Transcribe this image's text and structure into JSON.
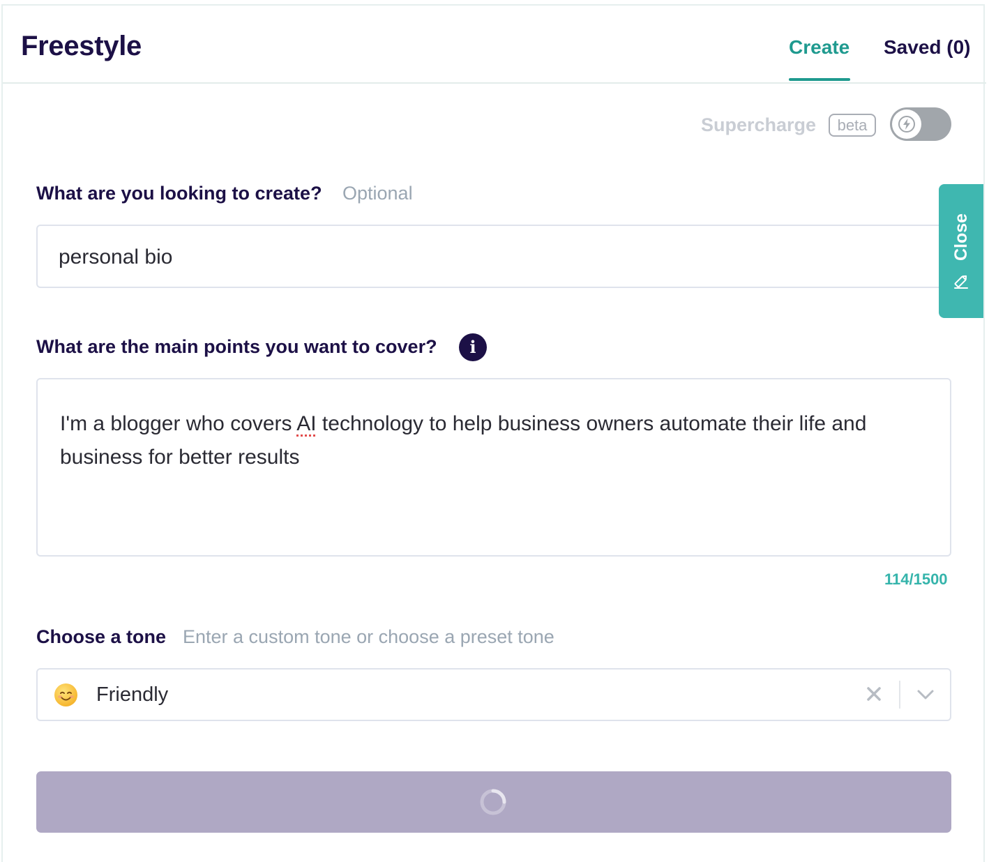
{
  "header": {
    "title": "Freestyle",
    "tabs": [
      {
        "label": "Create",
        "active": true
      },
      {
        "label": "Saved (0)",
        "active": false
      }
    ]
  },
  "supercharge": {
    "label": "Supercharge",
    "badge": "beta",
    "enabled": false,
    "icon": "lightning-bolt-icon"
  },
  "form": {
    "create": {
      "label": "What are you looking to create?",
      "hint": "Optional",
      "value": "personal bio"
    },
    "points": {
      "label": "What are the main points you want to cover?",
      "info_icon": "i",
      "value_prefix": "I'm a blogger who covers ",
      "value_flagged": "AI",
      "value_suffix": " technology to help business owners automate their life and business for better results",
      "counter": "114/1500"
    },
    "tone": {
      "label": "Choose a tone",
      "hint": "Enter a custom tone or choose a preset tone",
      "selected": "Friendly",
      "selected_icon": "smiling-face-icon"
    },
    "submit": {
      "state": "loading"
    }
  },
  "side_tab": {
    "label": "Close",
    "icon": "pencil-icon"
  },
  "colors": {
    "brand": "#1c1046",
    "accent": "#1f9a8f",
    "teal_tab": "#3fb7b0",
    "button_disabled": "#afa8c4",
    "toggle_off": "#a1a6ab"
  }
}
